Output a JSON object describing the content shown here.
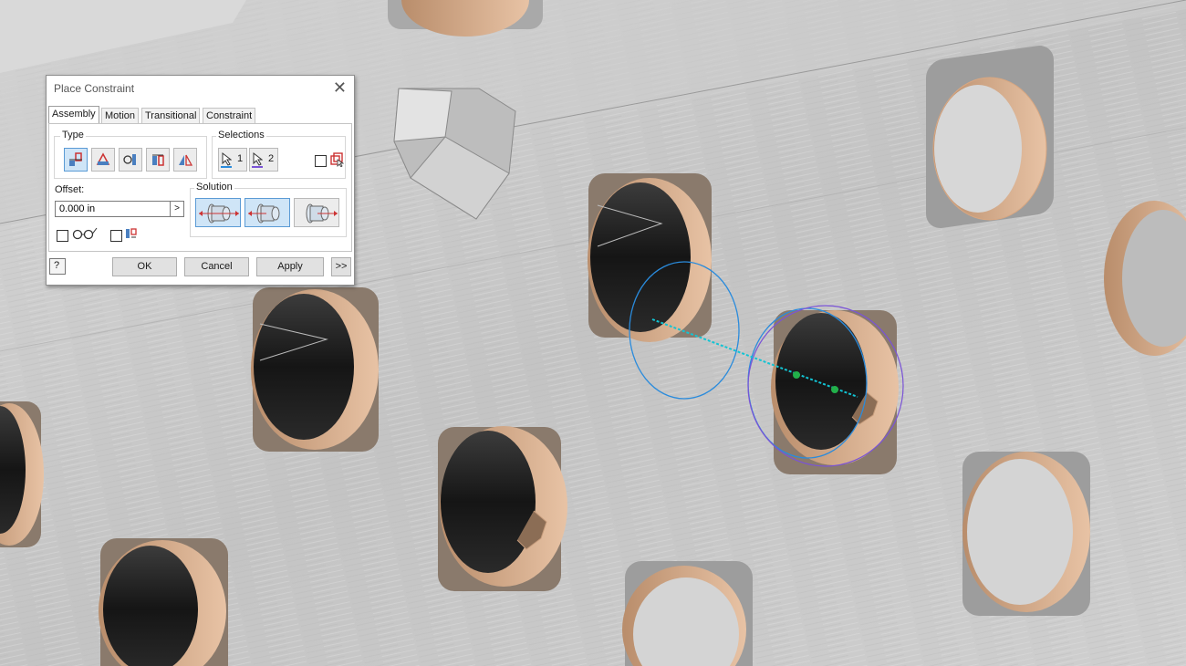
{
  "dialog": {
    "title": "Place Constraint",
    "close_glyph": "✕",
    "tabs": [
      "Assembly",
      "Motion",
      "Transitional",
      "Constraint Set"
    ],
    "active_tab": "Assembly",
    "type_group": {
      "label": "Type",
      "buttons": [
        "mate-constraint-icon",
        "angle-constraint-icon",
        "tangent-constraint-icon",
        "insert-constraint-icon",
        "symmetry-constraint-icon"
      ],
      "active": "mate-constraint-icon"
    },
    "selections_group": {
      "label": "Selections",
      "sel1": "1",
      "sel2": "2"
    },
    "offset": {
      "label": "Offset:",
      "value": "0.000 in",
      "arrow": ">"
    },
    "solution_group": {
      "label": "Solution",
      "buttons": [
        "mate-solution-icon",
        "flush-solution-icon",
        "undirected-solution-icon"
      ],
      "active": "mate-solution-icon"
    },
    "buttons": {
      "ok": "OK",
      "cancel": "Cancel",
      "apply": "Apply",
      "more": ">>"
    },
    "help_glyph": "?"
  },
  "colors": {
    "selection_blue": "#2a8bdc",
    "selection_purple": "#7a53d6",
    "axis_cyan": "#12c4d4",
    "point_green": "#22b04a",
    "part_copper": "#d9a781",
    "metal": "#c9c9c9",
    "hole_dark": "#1b1b1b",
    "button_active": "#cfe5f7"
  }
}
